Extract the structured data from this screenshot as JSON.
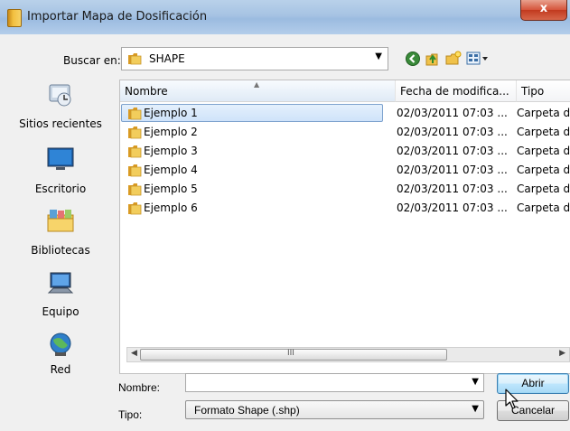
{
  "window": {
    "title": "Importar Mapa de Dosificación",
    "close_symbol": "x"
  },
  "look_in": {
    "label": "Buscar en:",
    "value": "SHAPE"
  },
  "toolbar": {
    "icons": [
      "back-icon",
      "up-folder-icon",
      "new-folder-icon",
      "view-menu-icon"
    ]
  },
  "places": [
    {
      "label": "Sitios recientes",
      "icon": "recent-places-icon"
    },
    {
      "label": "Escritorio",
      "icon": "desktop-icon"
    },
    {
      "label": "Bibliotecas",
      "icon": "libraries-icon"
    },
    {
      "label": "Equipo",
      "icon": "computer-icon"
    },
    {
      "label": "Red",
      "icon": "network-icon"
    }
  ],
  "columns": [
    "Nombre",
    "Fecha de modifica...",
    "Tipo"
  ],
  "files": [
    {
      "name": "Ejemplo 1",
      "date": "02/03/2011 07:03 ...",
      "type": "Carpeta d",
      "selected": true
    },
    {
      "name": "Ejemplo 2",
      "date": "02/03/2011 07:03 ...",
      "type": "Carpeta d",
      "selected": false
    },
    {
      "name": "Ejemplo 3",
      "date": "02/03/2011 07:03 ...",
      "type": "Carpeta d",
      "selected": false
    },
    {
      "name": "Ejemplo 4",
      "date": "02/03/2011 07:03 ...",
      "type": "Carpeta d",
      "selected": false
    },
    {
      "name": "Ejemplo 5",
      "date": "02/03/2011 07:03 ...",
      "type": "Carpeta d",
      "selected": false
    },
    {
      "name": "Ejemplo 6",
      "date": "02/03/2011 07:03 ...",
      "type": "Carpeta d",
      "selected": false
    }
  ],
  "filename": {
    "label": "Nombre:",
    "value": ""
  },
  "filetype": {
    "label": "Tipo:",
    "value": "Formato Shape (.shp)"
  },
  "buttons": {
    "open": "Abrir",
    "cancel": "Cancelar"
  },
  "colors": {
    "selection": "#cfe3fa",
    "folder": "#e9b949",
    "title_bar": "#a6c3e3",
    "close_button": "#c23a1f"
  }
}
